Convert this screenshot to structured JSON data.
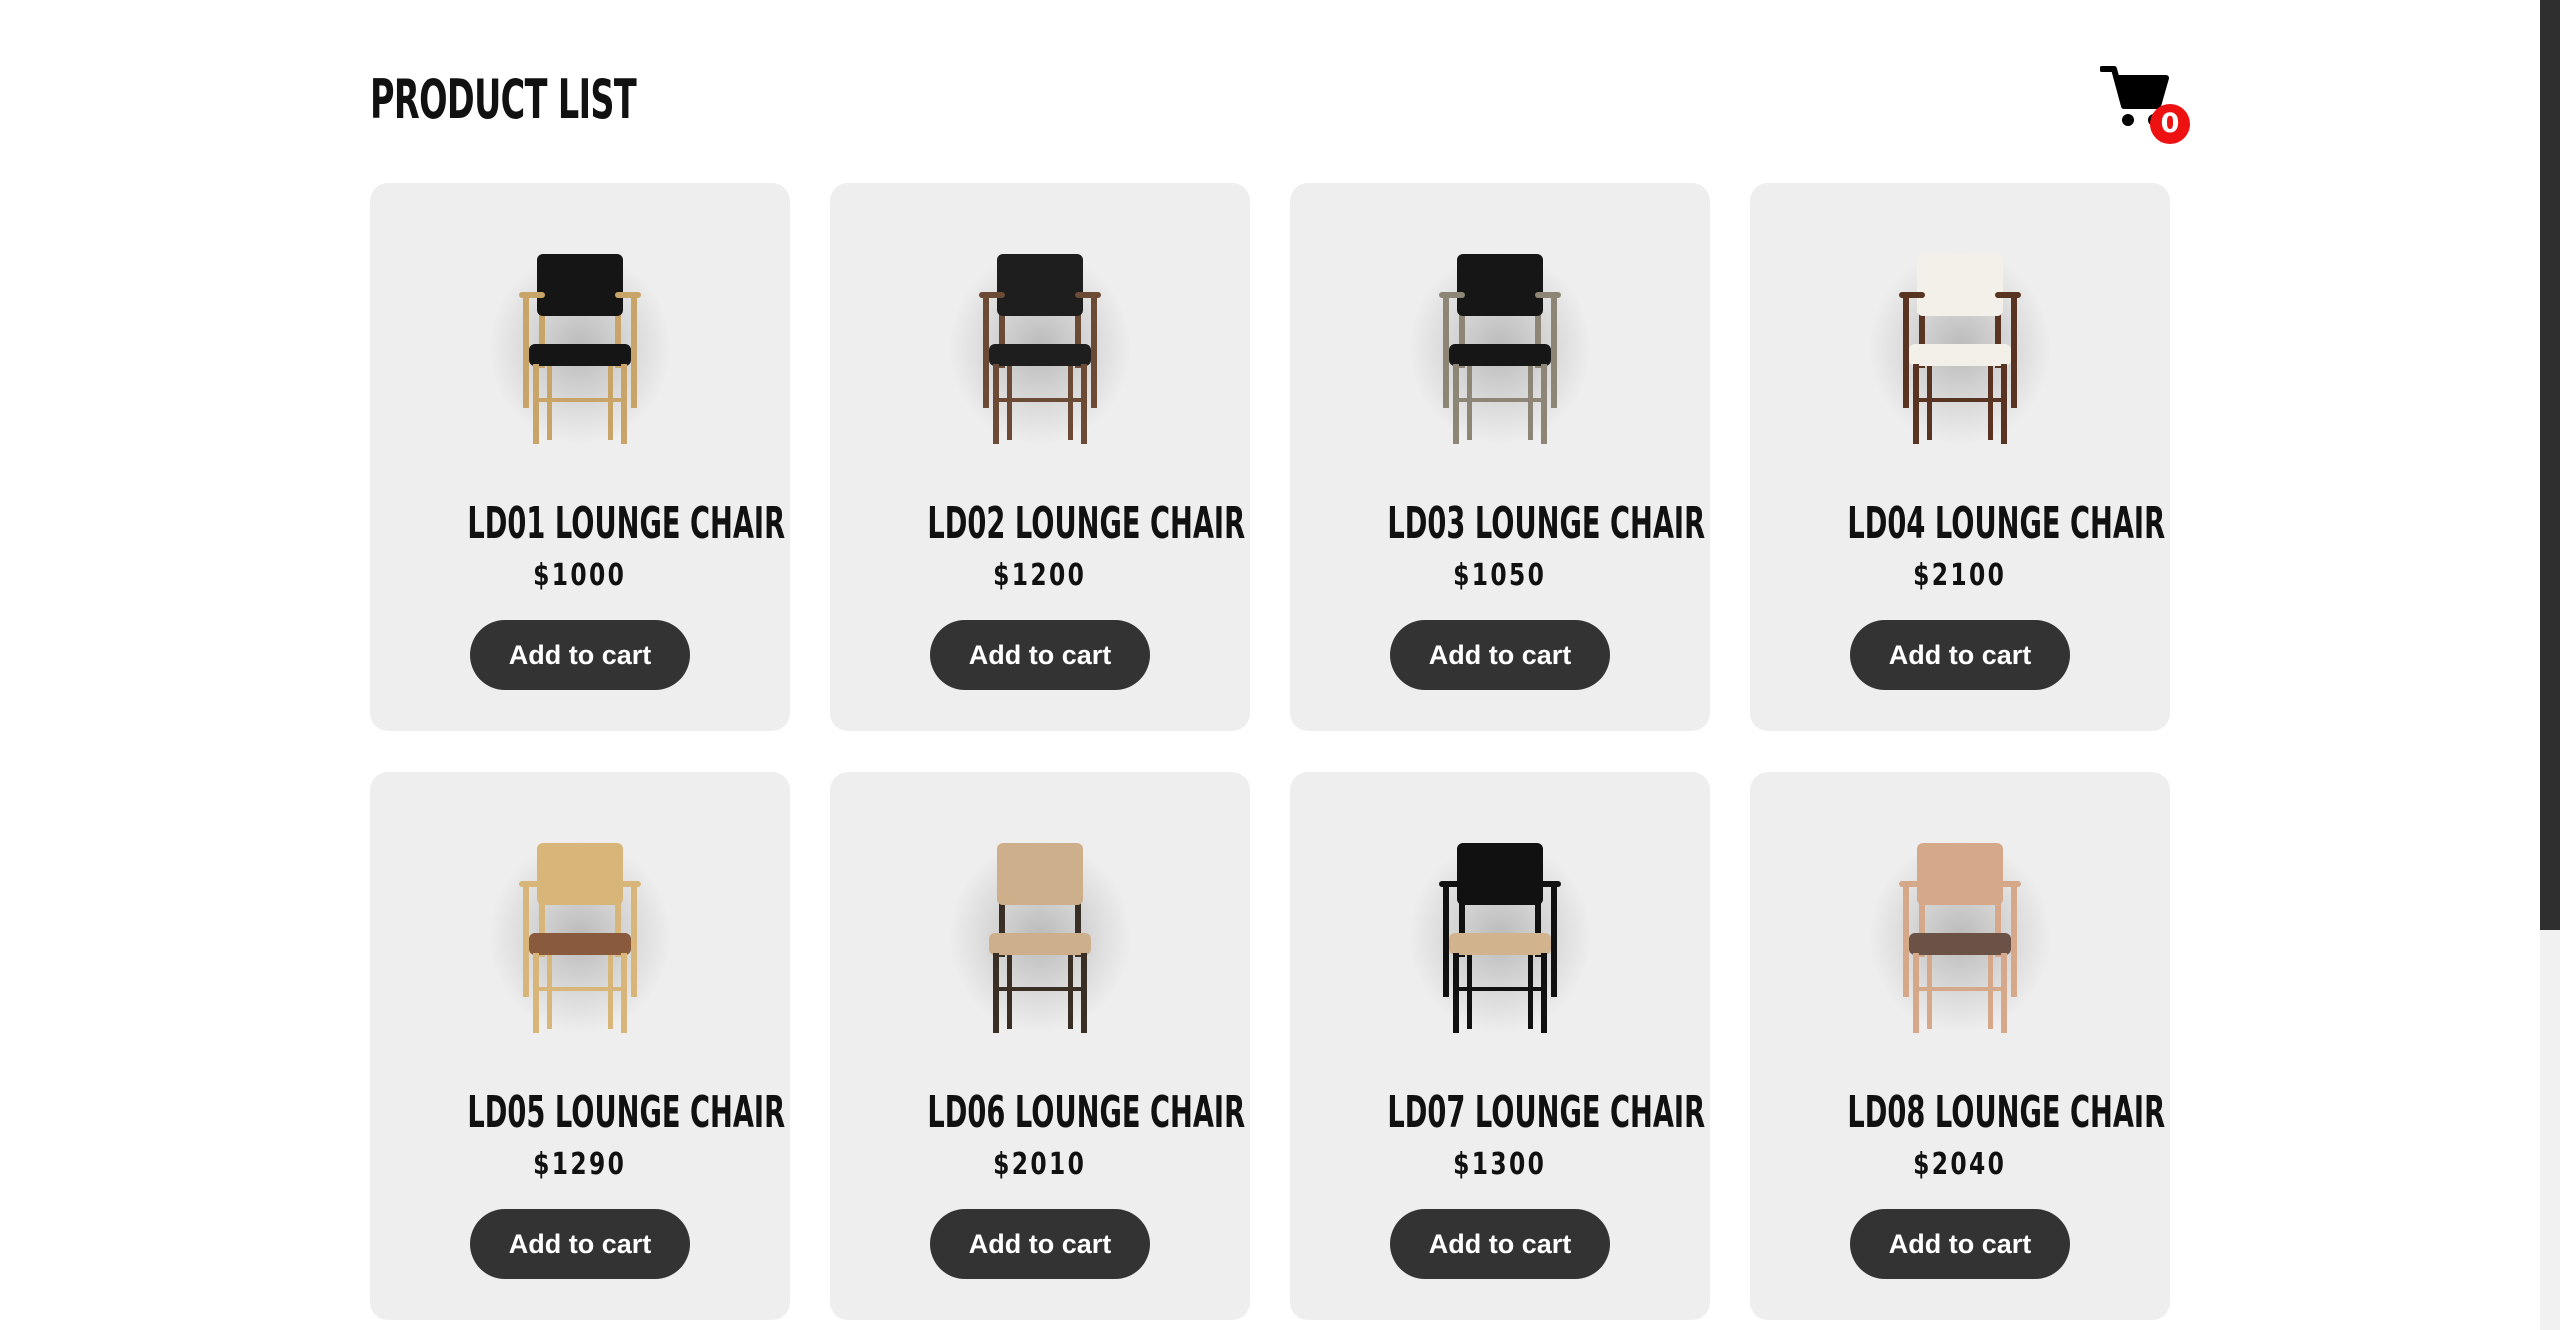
{
  "header": {
    "title": "PRODUCT LIST",
    "cart": {
      "icon": "shopping-cart-icon",
      "count": "0",
      "badge_color": "#ee1111"
    }
  },
  "products": [
    {
      "name": "LD01 LOUNGE CHAIR",
      "price": "$1000",
      "button_label": "Add to cart",
      "style": {
        "frame": "#c9a468",
        "seat": "#151515",
        "back": "#151515",
        "arms": true
      }
    },
    {
      "name": "LD02 LOUNGE CHAIR",
      "price": "$1200",
      "button_label": "Add to cart",
      "style": {
        "frame": "#6b4a36",
        "seat": "#1e1e1e",
        "back": "#1e1e1e",
        "arms": true
      }
    },
    {
      "name": "LD03 LOUNGE CHAIR",
      "price": "$1050",
      "button_label": "Add to cart",
      "style": {
        "frame": "#8d8576",
        "seat": "#161616",
        "back": "#161616",
        "arms": true
      }
    },
    {
      "name": "LD04 LOUNGE CHAIR",
      "price": "$2100",
      "button_label": "Add to cart",
      "style": {
        "frame": "#5a3422",
        "seat": "#f3f0ea",
        "back": "#f3f0ea",
        "arms": true
      }
    },
    {
      "name": "LD05 LOUNGE CHAIR",
      "price": "$1290",
      "button_label": "Add to cart",
      "style": {
        "frame": "#d8b578",
        "seat": "#8a5a3c",
        "back": "#d8b578",
        "arms": true
      }
    },
    {
      "name": "LD06 LOUNGE CHAIR",
      "price": "$2010",
      "button_label": "Add to cart",
      "style": {
        "frame": "#3a2f25",
        "seat": "#cdb08b",
        "back": "#cdb08b",
        "arms": false
      }
    },
    {
      "name": "LD07 LOUNGE CHAIR",
      "price": "$1300",
      "button_label": "Add to cart",
      "style": {
        "frame": "#111111",
        "seat": "#d1b48d",
        "back": "#111111",
        "arms": true
      }
    },
    {
      "name": "LD08 LOUNGE CHAIR",
      "price": "$2040",
      "button_label": "Add to cart",
      "style": {
        "frame": "#d6a88a",
        "seat": "#6a5246",
        "back": "#d6a88a",
        "arms": true
      }
    }
  ],
  "colors": {
    "card_background": "#eeeeee",
    "button_background": "#333333",
    "button_text": "#ffffff",
    "scrollbar_thumb": "#2f2f2f"
  }
}
